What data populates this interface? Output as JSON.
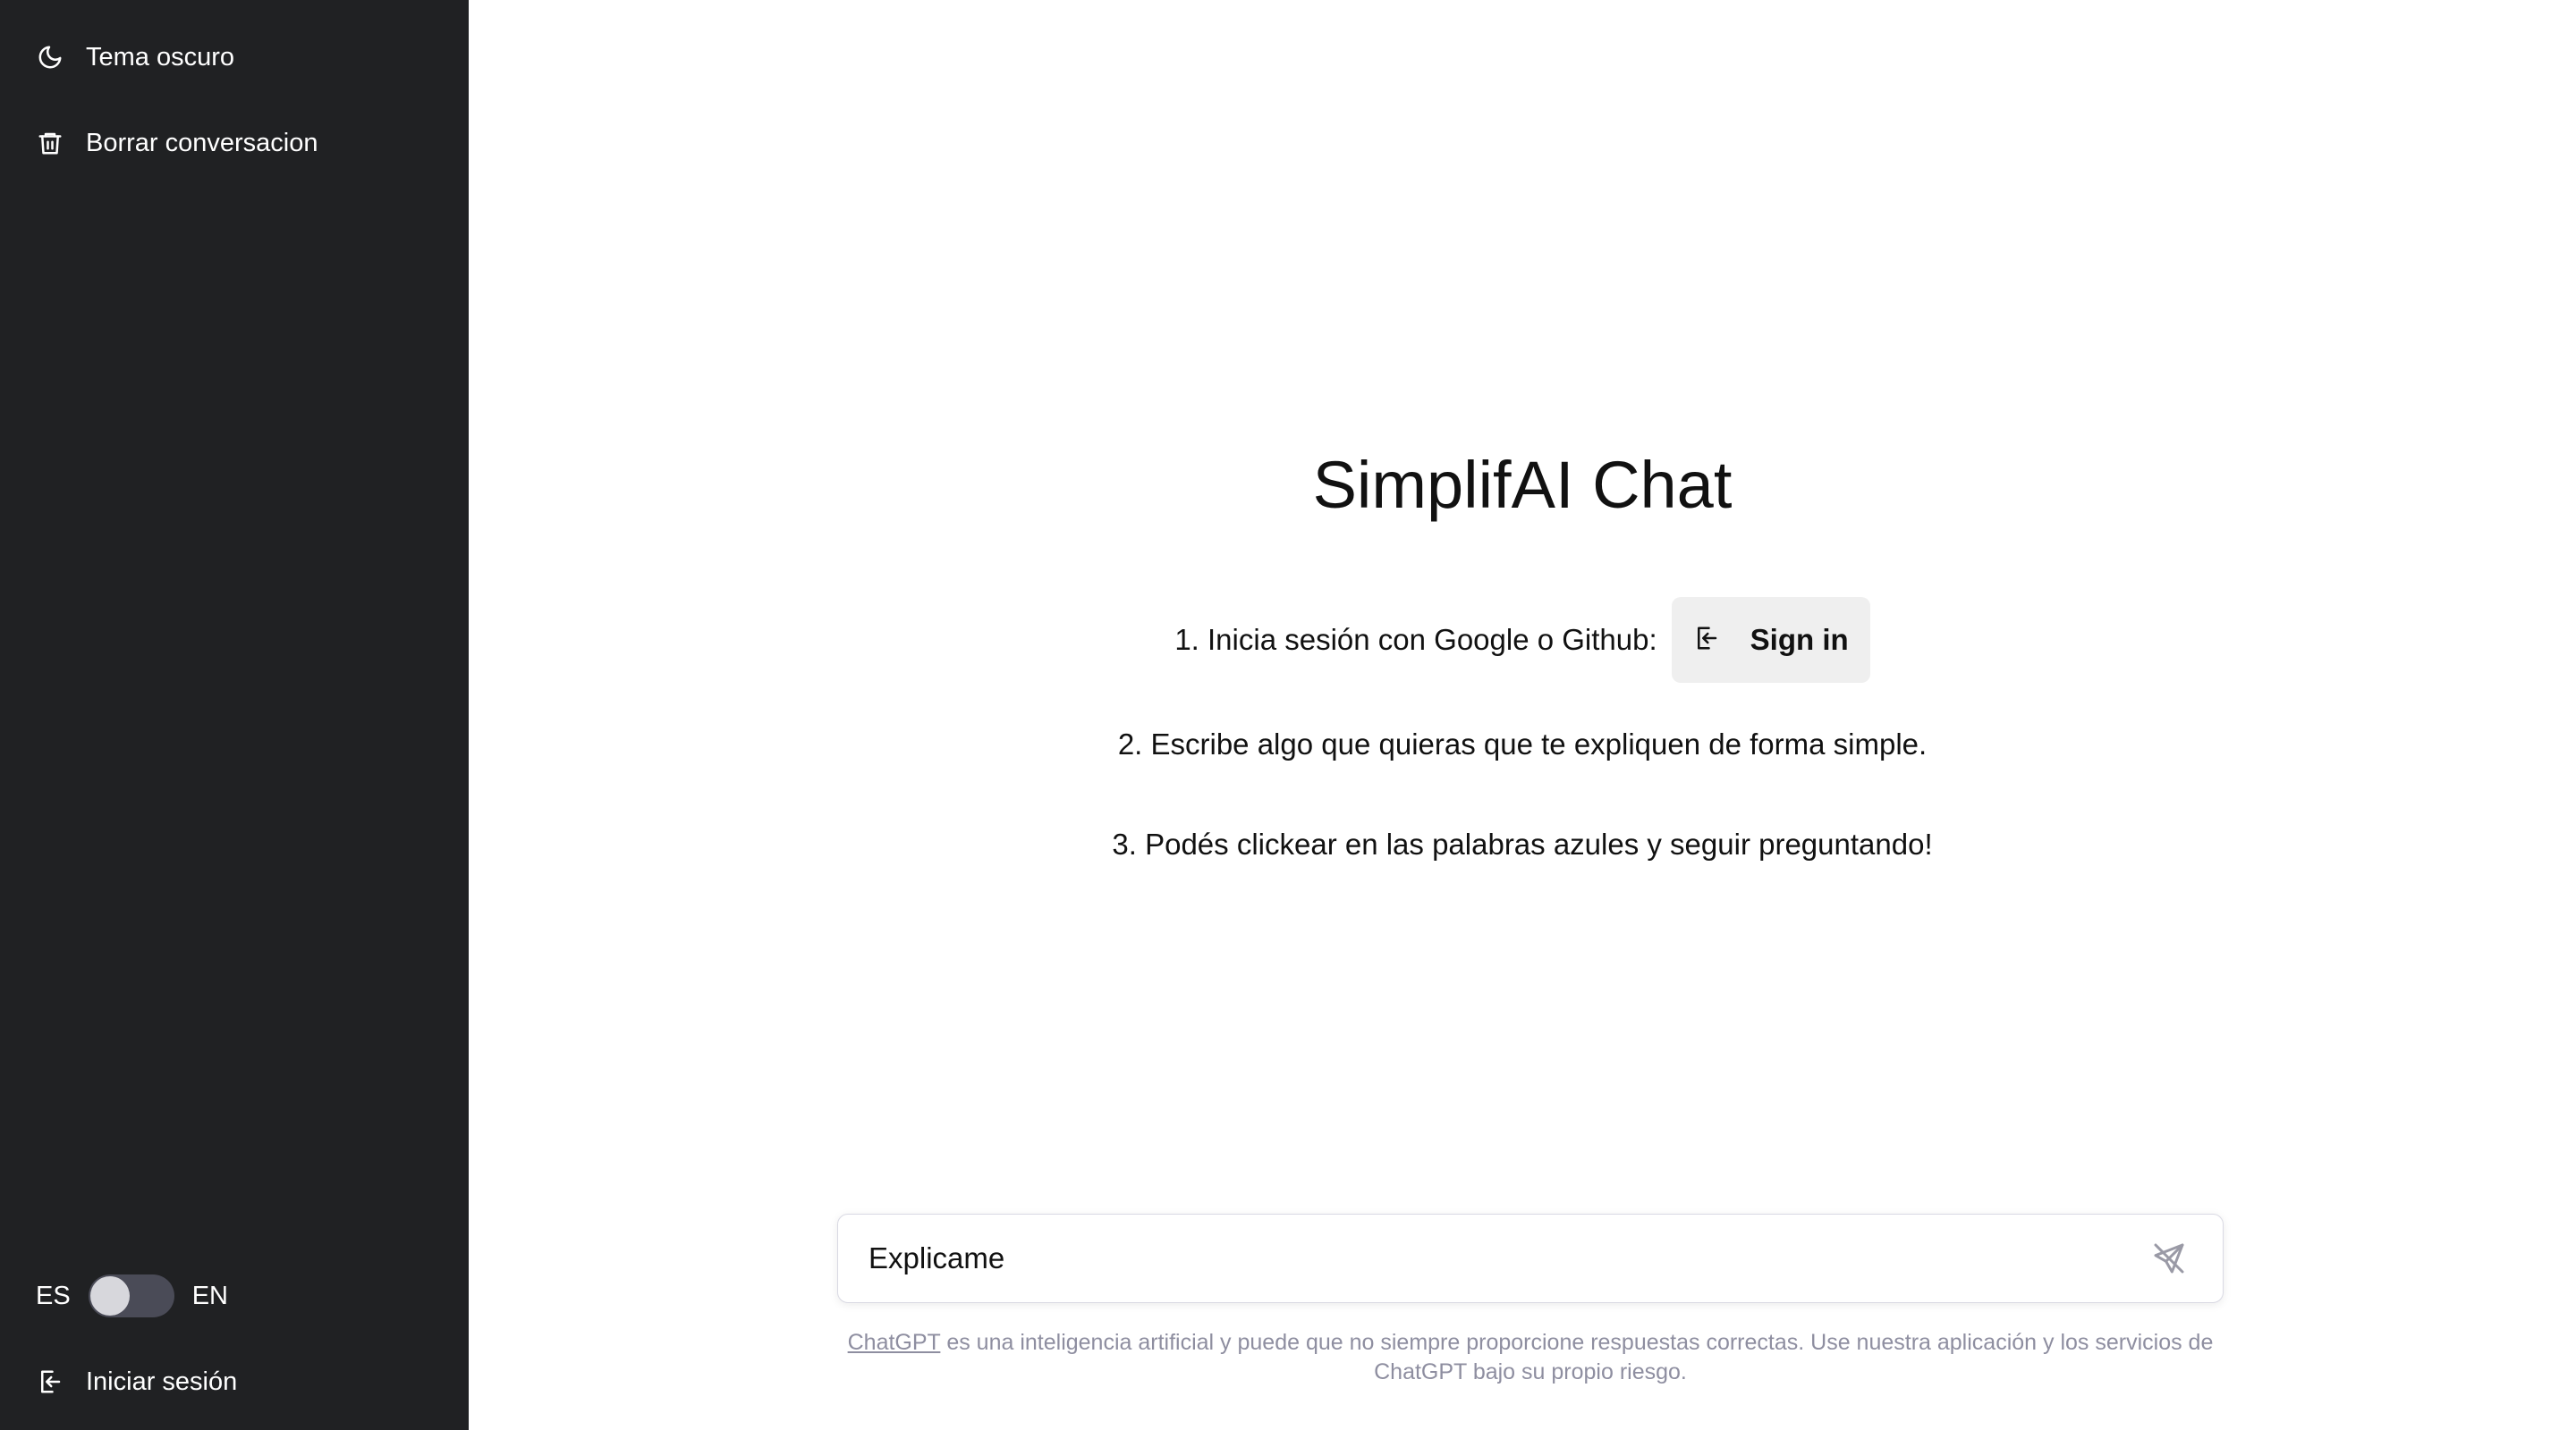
{
  "sidebar": {
    "dark_theme_label": "Tema oscuro",
    "clear_conversation_label": "Borrar conversacion",
    "lang_es": "ES",
    "lang_en": "EN",
    "lang_toggle_state": "ES",
    "login_label": "Iniciar sesión"
  },
  "main": {
    "title": "SimplifAI Chat",
    "step1": "1. Inicia sesión con Google o Github:",
    "signin_label": "Sign in",
    "step2": "2. Escribe algo que quieras que te expliquen de forma simple.",
    "step3": "3. Podés clickear en las palabras azules y seguir preguntando!",
    "input_value": "Explicame",
    "disclaimer_link": "ChatGPT",
    "disclaimer_text": " es una inteligencia artificial y puede que no siempre proporcione respuestas correctas. Use nuestra aplicación y los servicios de ChatGPT bajo su propio riesgo."
  },
  "icons": {
    "dark_theme": "moon-icon",
    "clear": "trash-icon",
    "login": "login-icon",
    "signin": "login-icon",
    "send": "send-icon"
  },
  "colors": {
    "sidebar_bg": "#202123",
    "toggle_bg": "#4a4b57",
    "signin_bg": "#efefef",
    "disclaimer": "#8e8ea0"
  }
}
